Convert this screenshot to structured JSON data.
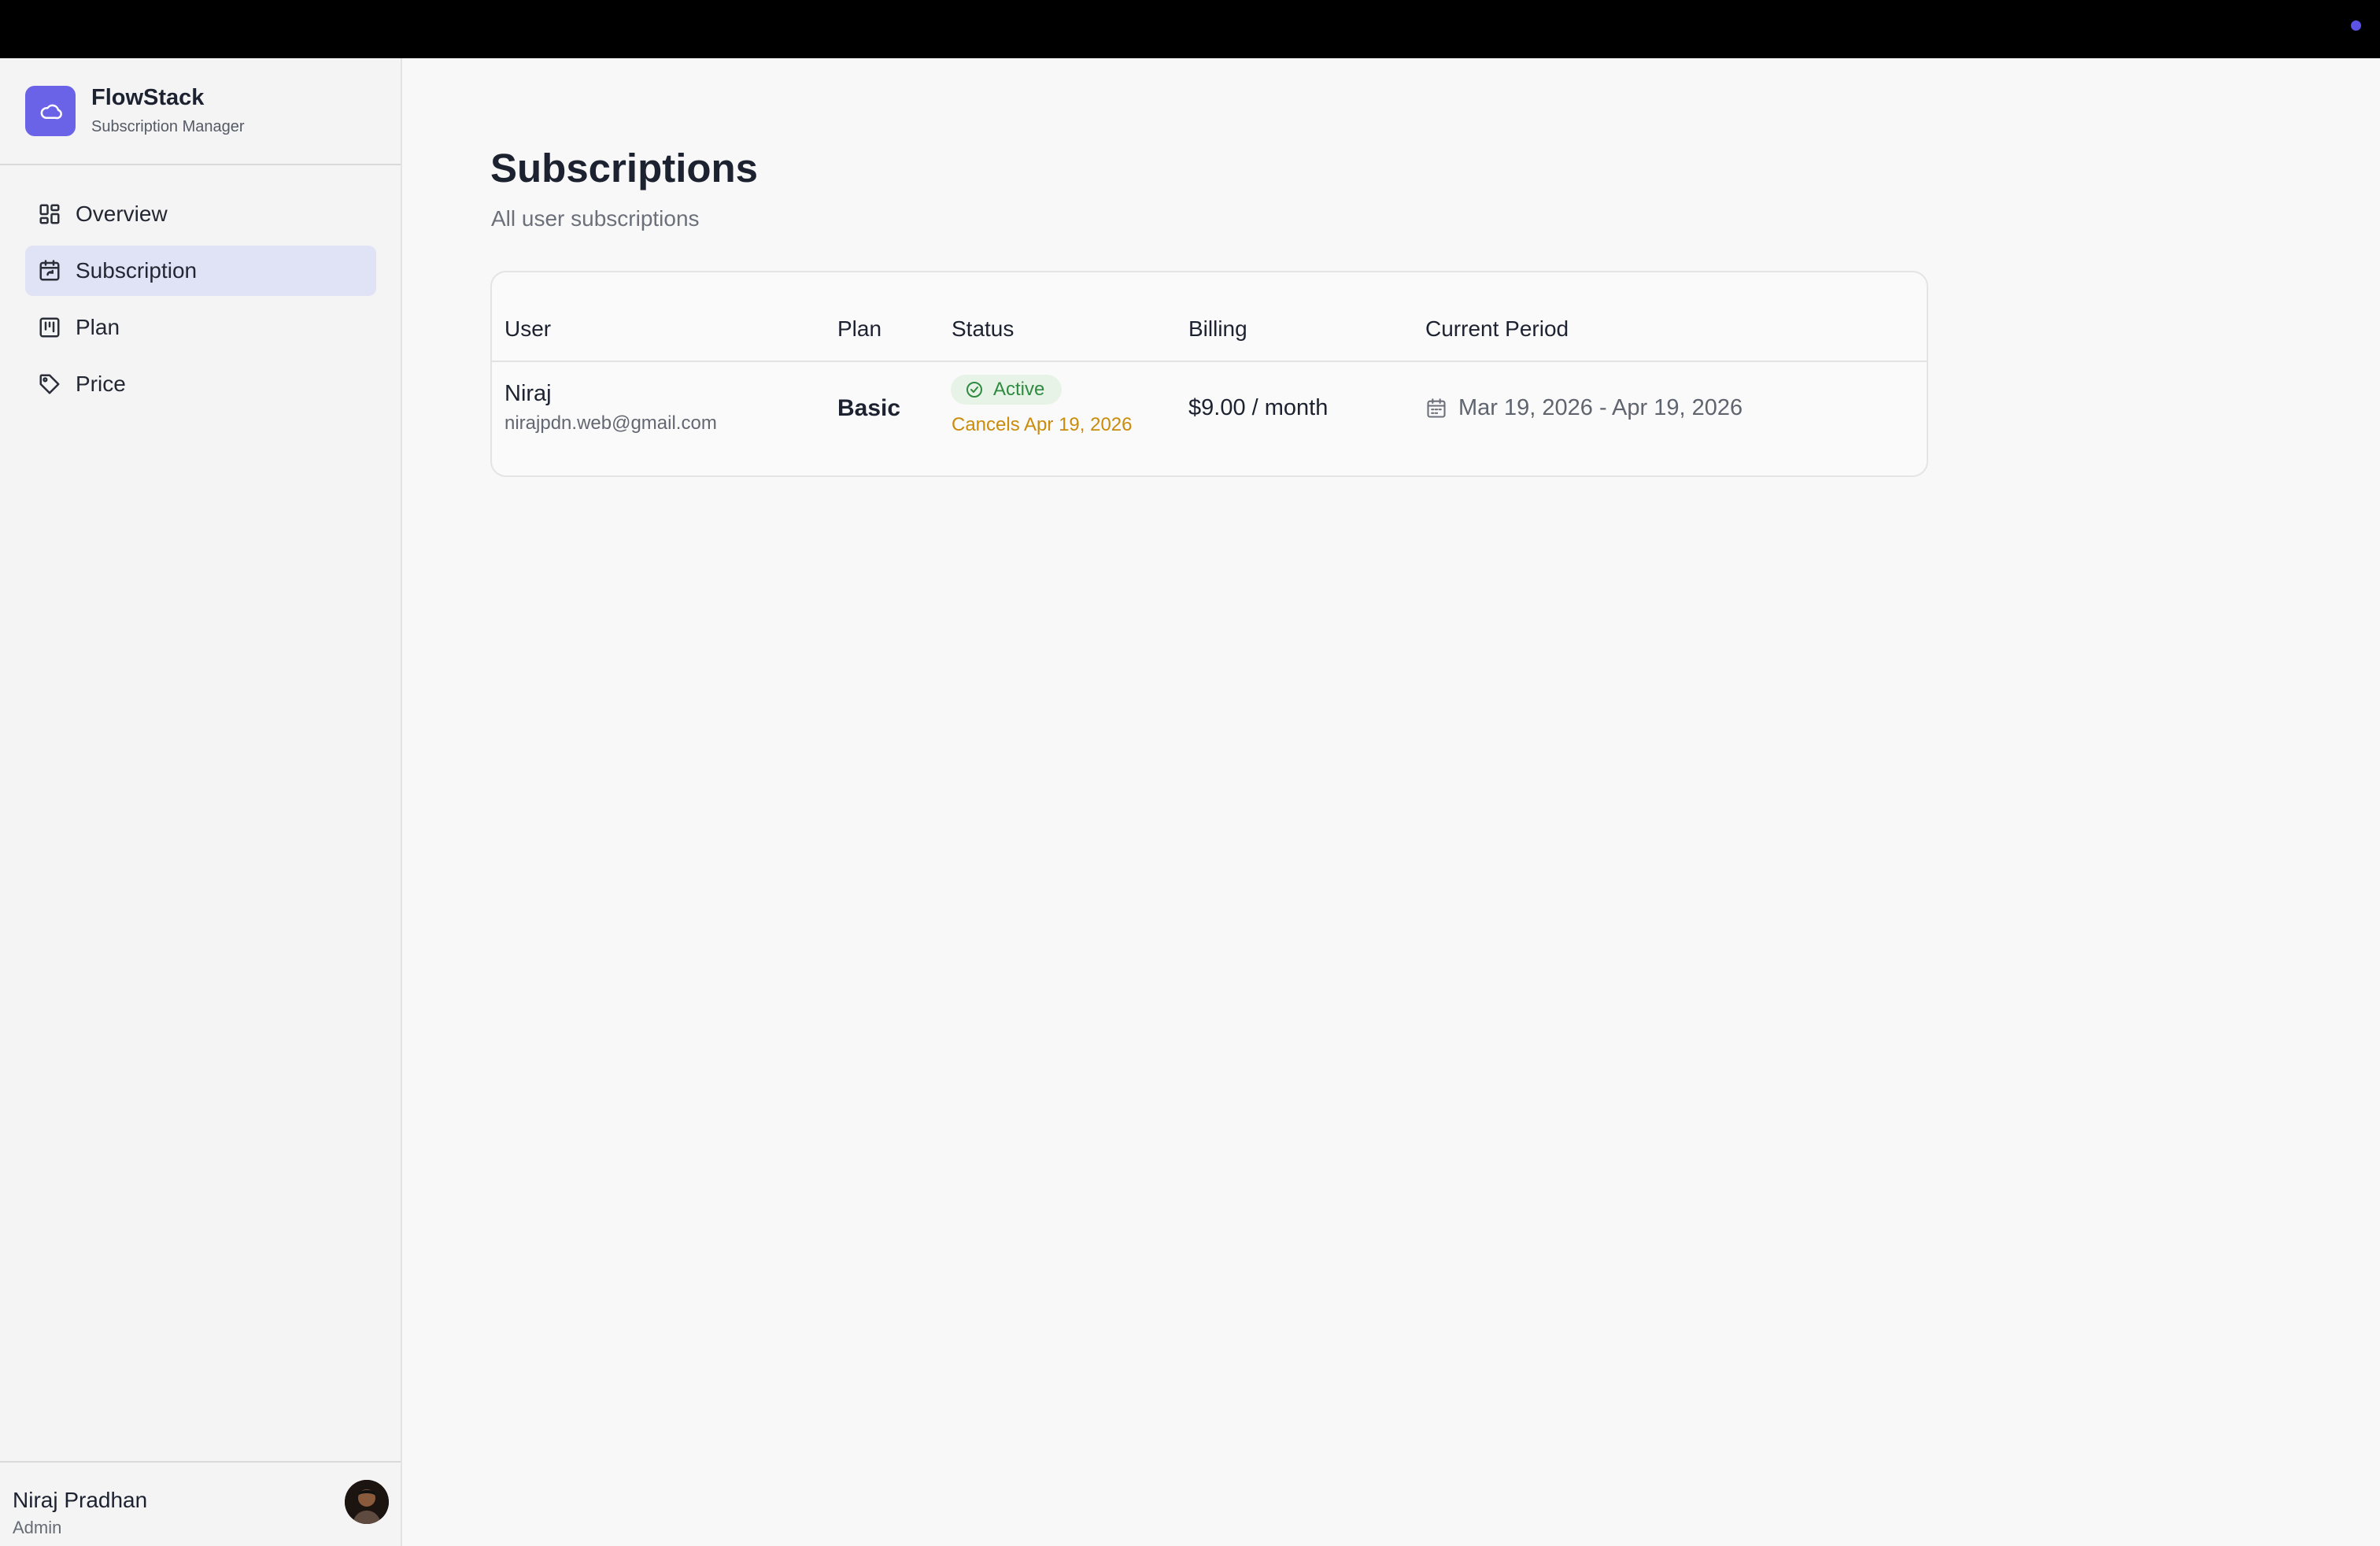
{
  "brand": {
    "name": "FlowStack",
    "subtitle": "Subscription Manager",
    "logo_icon": "cloud-icon",
    "accent_color": "#6a63e8"
  },
  "sidebar": {
    "items": [
      {
        "label": "Overview",
        "icon": "dashboard-grid-icon",
        "active": false
      },
      {
        "label": "Subscription",
        "icon": "calendar-sync-icon",
        "active": true
      },
      {
        "label": "Plan",
        "icon": "kanban-icon",
        "active": false
      },
      {
        "label": "Price",
        "icon": "tag-icon",
        "active": false
      }
    ]
  },
  "user": {
    "name": "Niraj Pradhan",
    "role": "Admin"
  },
  "page": {
    "title": "Subscriptions",
    "subtitle": "All user subscriptions"
  },
  "table": {
    "headers": [
      "User",
      "Plan",
      "Status",
      "Billing",
      "Current Period"
    ],
    "rows": [
      {
        "user_name": "Niraj",
        "user_email": "nirajpdn.web@gmail.com",
        "plan": "Basic",
        "status": "Active",
        "status_color": "#2e8b3f",
        "cancels": "Cancels Apr 19, 2026",
        "cancels_color": "#c98c0b",
        "billing": "$9.00 / month",
        "period": "Mar 19, 2026 - Apr 19, 2026"
      }
    ]
  }
}
